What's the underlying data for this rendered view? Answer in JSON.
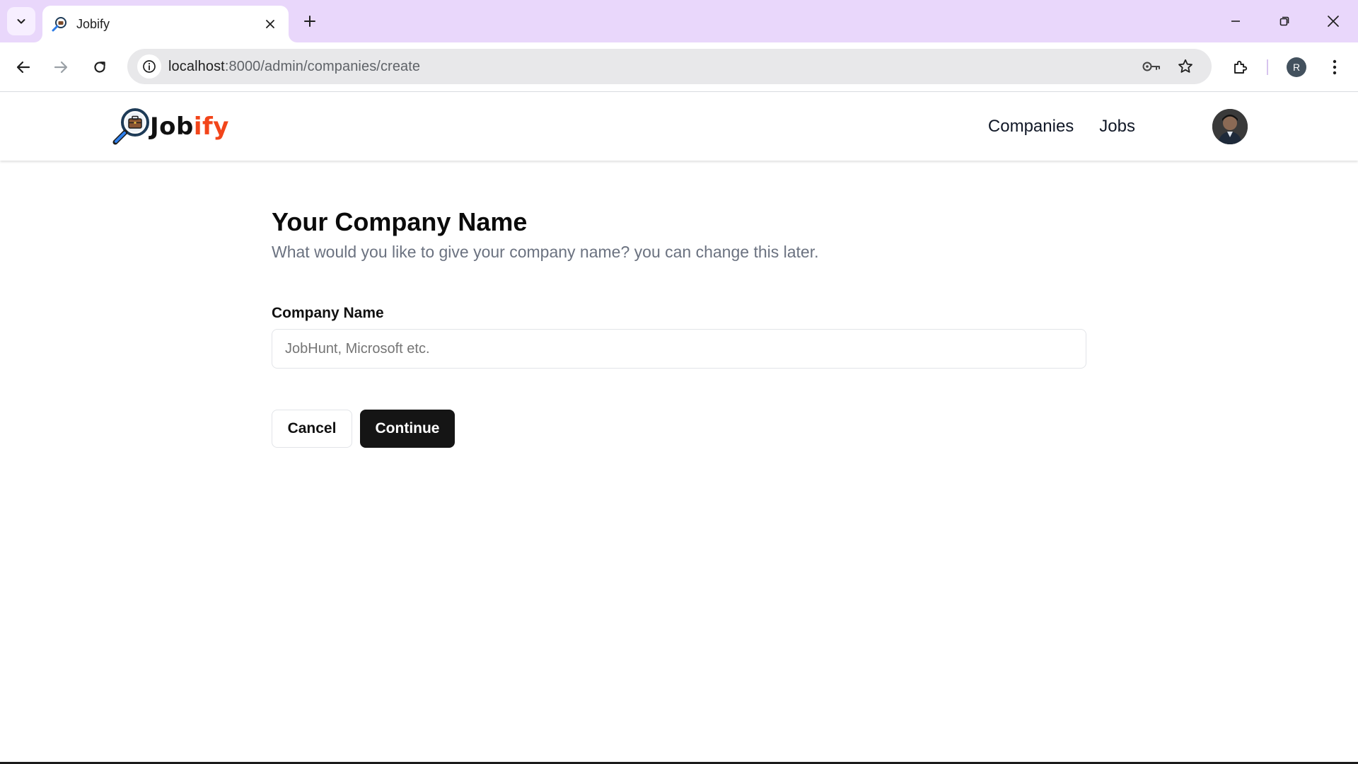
{
  "browser": {
    "tab_title": "Jobify",
    "url_host": "localhost",
    "url_path": ":8000/admin/companies/create",
    "profile_initial": "R"
  },
  "header": {
    "logo_prefix": "Job",
    "logo_suffix": "ify",
    "nav": [
      {
        "label": "Companies"
      },
      {
        "label": "Jobs"
      }
    ]
  },
  "form": {
    "title": "Your Company Name",
    "subtitle": "What would you like to give your company name? you can change this later.",
    "field_label": "Company Name",
    "field_value": "",
    "field_placeholder": "JobHunt, Microsoft etc.",
    "cancel_label": "Cancel",
    "continue_label": "Continue"
  },
  "colors": {
    "tabstrip_bg": "#e9d7fb",
    "logo_accent": "#f2451a",
    "primary_button": "#151515"
  }
}
